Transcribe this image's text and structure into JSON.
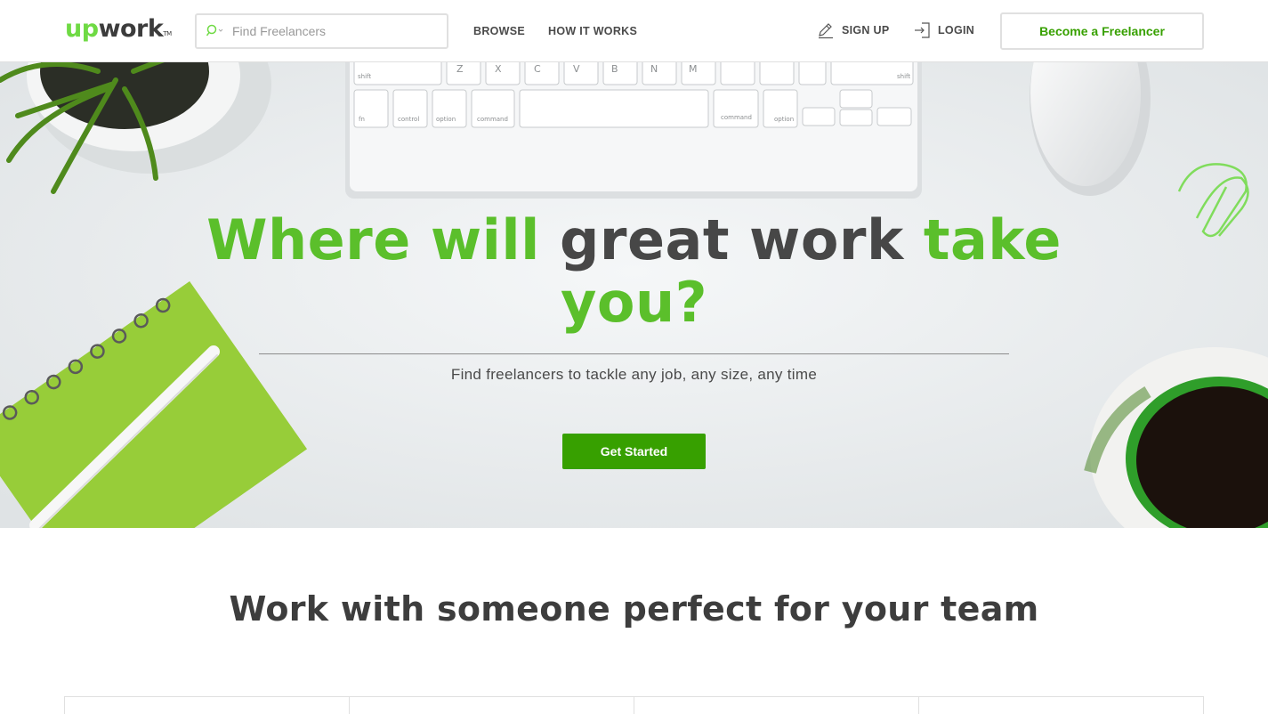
{
  "header": {
    "logo": {
      "up": "up",
      "work": "work",
      "tm": "TM"
    },
    "search": {
      "placeholder": "Find Freelancers",
      "icon": "search-icon"
    },
    "nav": [
      {
        "label": "BROWSE"
      },
      {
        "label": "HOW IT WORKS"
      }
    ],
    "signup": {
      "label": "SIGN UP",
      "icon": "pencil-icon"
    },
    "login": {
      "label": "LOGIN",
      "icon": "login-icon"
    },
    "become_freelancer": "Become a Freelancer"
  },
  "hero": {
    "title_parts": [
      "Where will",
      "great work",
      "take",
      "you?"
    ],
    "subtitle": "Find freelancers to tackle any job, any size, any time",
    "cta": "Get Started"
  },
  "section": {
    "title": "Work with someone perfect for your team",
    "card_count": 4
  },
  "colors": {
    "brand_green": "#37a000",
    "title_green": "#5bbf2b",
    "logo_green": "#6fda44",
    "dark_text": "#474747"
  }
}
